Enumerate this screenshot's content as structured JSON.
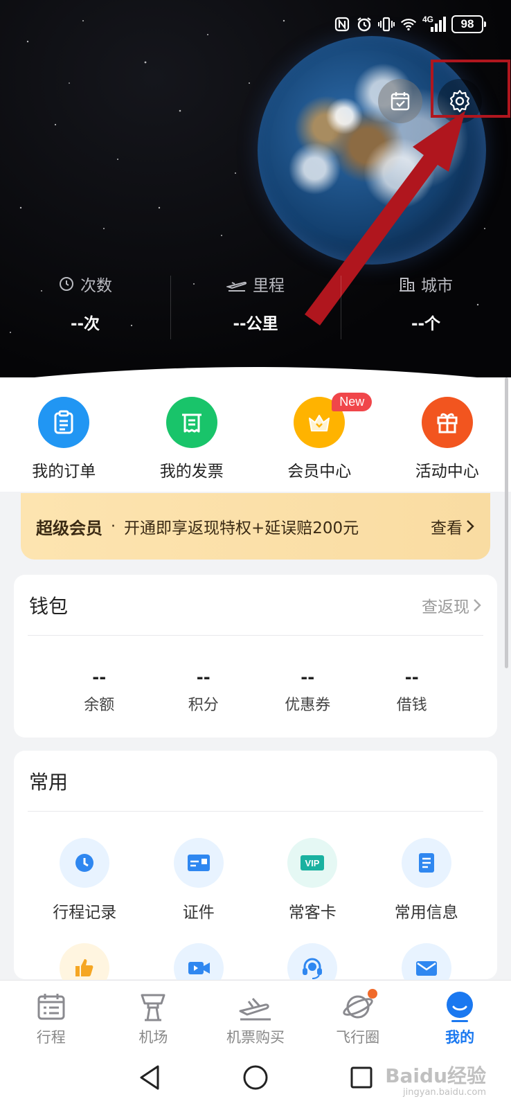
{
  "status_bar": {
    "icons": [
      "nfc-icon",
      "alarm-icon",
      "vibrate-icon",
      "wifi-icon",
      "signal-icon"
    ],
    "network": "4G",
    "battery": "98"
  },
  "hero": {
    "stats": [
      {
        "label": "次数",
        "value": "--次",
        "icon": "clock-icon"
      },
      {
        "label": "里程",
        "value": "--公里",
        "icon": "plane-icon"
      },
      {
        "label": "城市",
        "value": "--个",
        "icon": "building-icon"
      }
    ]
  },
  "quick_nav": [
    {
      "label": "我的订单",
      "color": "#2196f3",
      "icon": "clipboard-icon"
    },
    {
      "label": "我的发票",
      "color": "#19c46a",
      "icon": "receipt-icon"
    },
    {
      "label": "会员中心",
      "color": "#ffb300",
      "icon": "crown-icon",
      "badge": "New"
    },
    {
      "label": "活动中心",
      "color": "#f2551f",
      "icon": "gift-icon"
    }
  ],
  "banner": {
    "title": "超级会员",
    "separator": "·",
    "text": "开通即享返现特权+延误赔200元",
    "link": "查看"
  },
  "wallet": {
    "title": "钱包",
    "link": "查返现",
    "items": [
      {
        "value": "--",
        "label": "余额"
      },
      {
        "value": "--",
        "label": "积分"
      },
      {
        "value": "--",
        "label": "优惠券"
      },
      {
        "value": "--",
        "label": "借钱"
      }
    ]
  },
  "common": {
    "title": "常用",
    "items": [
      {
        "label": "行程记录",
        "icon": "history-icon"
      },
      {
        "label": "证件",
        "icon": "id-card-icon"
      },
      {
        "label": "常客卡",
        "icon": "vip-card-icon"
      },
      {
        "label": "常用信息",
        "icon": "document-icon"
      },
      {
        "label": "",
        "icon": "thumbs-up-icon"
      },
      {
        "label": "",
        "icon": "video-icon"
      },
      {
        "label": "",
        "icon": "headset-icon"
      },
      {
        "label": "",
        "icon": "mail-icon"
      }
    ]
  },
  "tabbar": [
    {
      "label": "行程",
      "icon": "itinerary-icon"
    },
    {
      "label": "机场",
      "icon": "airport-tower-icon"
    },
    {
      "label": "机票购买",
      "icon": "plane-ticket-icon"
    },
    {
      "label": "飞行圈",
      "icon": "planet-icon",
      "dot": true
    },
    {
      "label": "我的",
      "icon": "profile-icon",
      "active": true
    }
  ],
  "watermark": {
    "text": "Baidu经验",
    "sub": "jingyan.baidu.com"
  }
}
